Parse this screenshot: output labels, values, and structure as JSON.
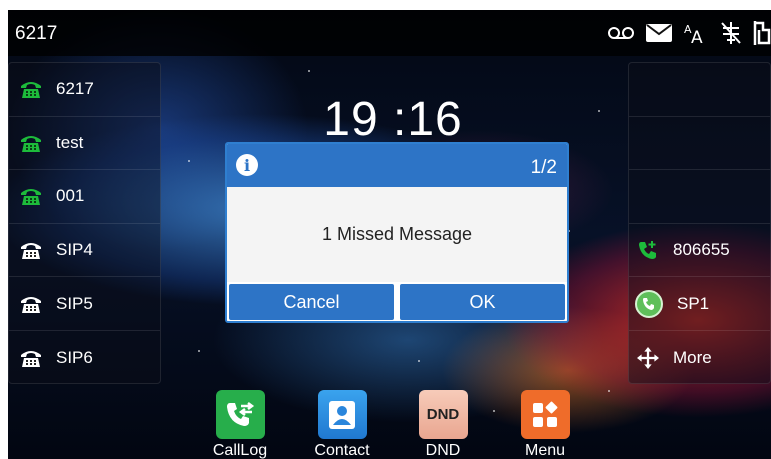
{
  "status_bar": {
    "account": "6217",
    "icons": [
      "voicemail-icon",
      "message-icon",
      "font-size-icon",
      "network-unavailable-icon",
      "ethernet-icon"
    ]
  },
  "clock": {
    "time": "19 :16"
  },
  "left_keys": [
    {
      "label": "6217",
      "icon": "phone-registered-icon",
      "color": "#1dbb3b"
    },
    {
      "label": "test",
      "icon": "phone-registered-icon",
      "color": "#1dbb3b"
    },
    {
      "label": "001",
      "icon": "phone-registered-icon",
      "color": "#1dbb3b"
    },
    {
      "label": "SIP4",
      "icon": "phone-unregistered-icon",
      "color": "#ffffff"
    },
    {
      "label": "SIP5",
      "icon": "phone-unregistered-icon",
      "color": "#ffffff"
    },
    {
      "label": "SIP6",
      "icon": "phone-unregistered-icon",
      "color": "#ffffff"
    }
  ],
  "right_keys": [
    {
      "label": "",
      "icon": ""
    },
    {
      "label": "",
      "icon": ""
    },
    {
      "label": "",
      "icon": ""
    },
    {
      "label": "806655",
      "icon": "speed-dial-icon",
      "color": "#1dbb3b"
    },
    {
      "label": "SP1",
      "icon": "sp-call-icon",
      "color": "#1dbb3b"
    },
    {
      "label": "More",
      "icon": "more-icon",
      "color": "#ffffff"
    }
  ],
  "dialog": {
    "page": "1/2",
    "message": "1 Missed Message",
    "cancel_label": "Cancel",
    "ok_label": "OK",
    "accent_color": "#2d74c6"
  },
  "dock": [
    {
      "label": "CallLog",
      "icon": "call-log-icon",
      "color": "#27ae4b"
    },
    {
      "label": "Contact",
      "icon": "contact-icon",
      "color": "#2e8fe0"
    },
    {
      "label": "DND",
      "icon": "dnd-icon",
      "icon_text": "DND",
      "color": "#f3b9a6"
    },
    {
      "label": "Menu",
      "icon": "menu-icon",
      "color": "#ef6c2a"
    }
  ]
}
